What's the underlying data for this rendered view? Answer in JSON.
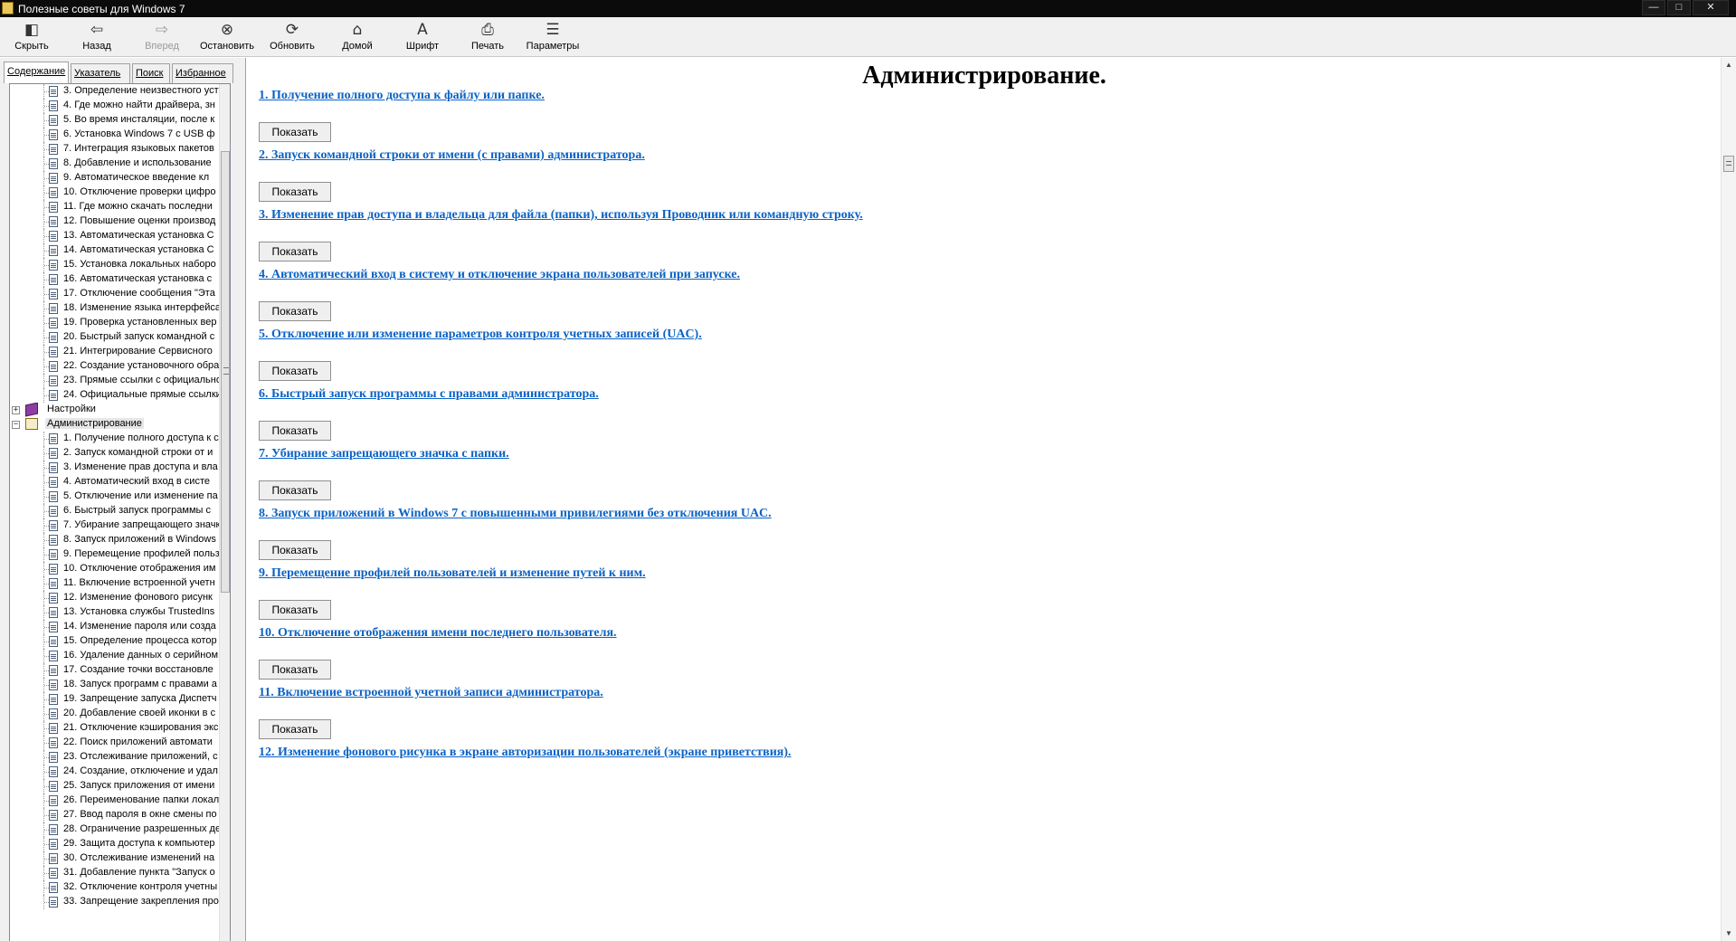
{
  "window": {
    "title": "Полезные советы для Windows 7",
    "controls": {
      "minimize": "—",
      "maximize": "□",
      "close": "✕"
    }
  },
  "toolbar": {
    "buttons": [
      {
        "label": "Скрыть",
        "icon": "hide-icon",
        "glyph": "◧",
        "enabled": true
      },
      {
        "label": "Назад",
        "icon": "back-arrow-icon",
        "glyph": "⇦",
        "enabled": true
      },
      {
        "label": "Вперед",
        "icon": "forward-arrow-icon",
        "glyph": "⇨",
        "enabled": false
      },
      {
        "label": "Остановить",
        "icon": "stop-icon",
        "glyph": "⊗",
        "enabled": true
      },
      {
        "label": "Обновить",
        "icon": "refresh-icon",
        "glyph": "⟳",
        "enabled": true
      },
      {
        "label": "Домой",
        "icon": "home-icon",
        "glyph": "⌂",
        "enabled": true
      },
      {
        "label": "Шрифт",
        "icon": "font-icon",
        "glyph": "A",
        "enabled": true
      },
      {
        "label": "Печать",
        "icon": "print-icon",
        "glyph": "⎙",
        "enabled": true
      },
      {
        "label": "Параметры",
        "icon": "options-icon",
        "glyph": "☰",
        "enabled": true
      }
    ]
  },
  "nav_tabs": [
    {
      "label": "Содержание",
      "active": true
    },
    {
      "label": "Указатель",
      "active": false
    },
    {
      "label": "Поиск",
      "active": false
    },
    {
      "label": "Избранное",
      "active": false
    }
  ],
  "tree": {
    "section_above_items": [
      "3. Определение неизвестного уст",
      "4. Где можно найти драйвера, зн",
      "5. Во время инсталяции, после к",
      "6. Установка Windows 7 с USB ф",
      "7. Интеграция языковых пакетов",
      "8. Добавление и использование",
      "9. Автоматическое введение кл",
      "10. Отключение проверки цифро",
      "11. Где можно скачать последни",
      "12. Повышение оценки производ",
      "13. Автоматическая установка С",
      "14. Автоматическая установка С",
      "15. Установка локальных наборо",
      "16. Автоматическая установка с",
      "17. Отключение сообщения \"Эта",
      "18. Изменение языка интерфейса",
      "19. Проверка установленных вер",
      "20. Быстрый запуск командной с",
      "21. Интегрирование Сервисного",
      "22. Создание установочного обра",
      "23. Прямые ссылки с официально",
      "24. Официальные прямые ссылки"
    ],
    "folder_settings": {
      "label": "Настройки",
      "expander": "+"
    },
    "folder_admin": {
      "label": "Администрирование",
      "expander": "−"
    },
    "admin_items": [
      "1. Получение полного доступа к с",
      "2. Запуск командной строки от и",
      "3. Изменение прав доступа и вла",
      "4. Автоматический вход в систе",
      "5. Отключение или изменение па",
      "6. Быстрый запуск программы с",
      "7. Убирание запрещающего значк",
      "8. Запуск приложений в Windows",
      "9. Перемещение профилей польз",
      "10. Отключение отображения им",
      "11. Включение встроенной учетн",
      "12. Изменение фонового рисунк",
      "13. Установка службы TrustedIns",
      "14. Изменение пароля или созда",
      "15. Определение процесса котор",
      "16. Удаление данных о серийном",
      "17. Создание точки восстановле",
      "18. Запуск программ с правами а",
      "19. Запрещение запуска Диспетч",
      "20. Добавление своей иконки в с",
      "21. Отключение кэширования экс",
      "22. Поиск приложений автомати",
      "23. Отслеживание приложений, с",
      "24. Создание, отключение и удал",
      "25. Запуск приложения от имени",
      "26. Переименование папки локал",
      "27. Ввод пароля в окне смены по",
      "28. Ограничение разрешенных де",
      "29. Защита доступа к компьютер",
      "30. Отслеживание изменений на",
      "31. Добавление пункта \"Запуск о",
      "32. Отключение контроля учетны",
      "33. Запрещение закрепления про"
    ]
  },
  "content": {
    "title": "Администрирование.",
    "show_button_label": "Показать",
    "topics": [
      "1. Получение полного доступа к файлу или папке.",
      "2. Запуск командной строки от имени (с правами) администратора.",
      "3. Изменение прав доступа и владельца для файла (папки), используя Проводник или командную строку.",
      "4. Автоматический вход в систему и отключение экрана пользователей при запуске.",
      "5. Отключение или изменение параметров контроля учетных записей (UAC).",
      "6. Быстрый запуск программы с правами администратора.",
      "7. Убирание запрещающего значка с папки.",
      "8. Запуск приложений в Windows 7 с повышенными привилегиями без отключения UAC.",
      "9. Перемещение профилей пользователей и изменение путей к ним.",
      "10. Отключение отображения имени последнего пользователя.",
      "11. Включение встроенной учетной записи администратора.",
      "12. Изменение фонового рисунка в экране авторизации пользователей (экране приветствия)."
    ]
  },
  "colors": {
    "link": "#0b62c4",
    "titlebar": "#0b0b0b",
    "chrome": "#f0f0f0"
  }
}
